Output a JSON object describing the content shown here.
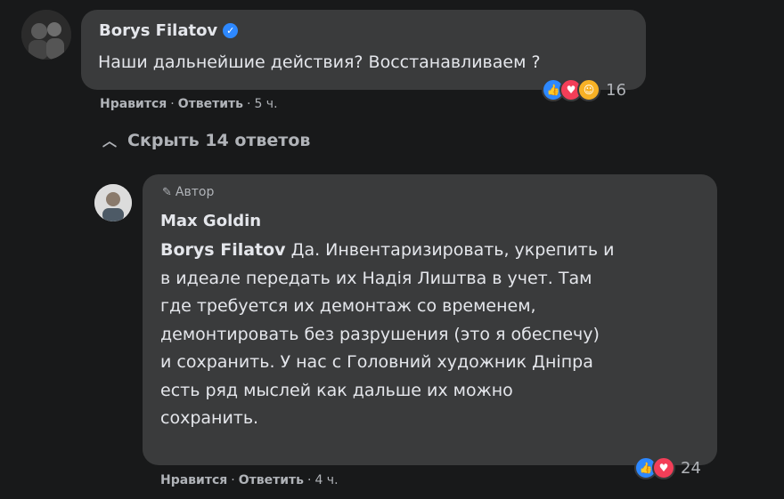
{
  "comment": {
    "author": "Borys Filatov",
    "verified_icon": "verified-badge-icon",
    "text": "Наши дальнейшие действия? Восстанавливаем ?",
    "reactions": {
      "icons": [
        "like-icon",
        "love-icon",
        "care-icon"
      ],
      "count": "16"
    },
    "actions": {
      "like": "Нравится",
      "reply": "Ответить",
      "time": "5 ч."
    }
  },
  "replies_toggle": {
    "label": "Скрыть 14 ответов",
    "icon": "chevron-up-icon"
  },
  "reply": {
    "badge": "Автор",
    "badge_icon": "pen-icon",
    "author": "Max Goldin",
    "mention": "Borys Filatov",
    "lines": [
      " Да. Инвентаризировать, укрепить и",
      "в идеале передать их Надія Лиштва в учет. Там",
      "где требуется их демонтаж со временем,",
      "демонтировать без разрушения (это я обеспечу)",
      "и сохранить. У нас с Головний художник Дніпра",
      "есть ряд мыслей как дальше их можно",
      "сохранить."
    ],
    "reactions": {
      "icons": [
        "like-icon",
        "love-icon"
      ],
      "count": "24"
    },
    "actions": {
      "like": "Нравится",
      "reply": "Ответить",
      "time": "4 ч."
    }
  },
  "colors": {
    "background": "#18191a",
    "bubble": "#3a3b3c",
    "text": "#e4e6eb",
    "secondary_text": "#b0b3b8",
    "like_blue": "#2d88ff",
    "love_red": "#f33e58",
    "care_yellow": "#f7b125"
  }
}
